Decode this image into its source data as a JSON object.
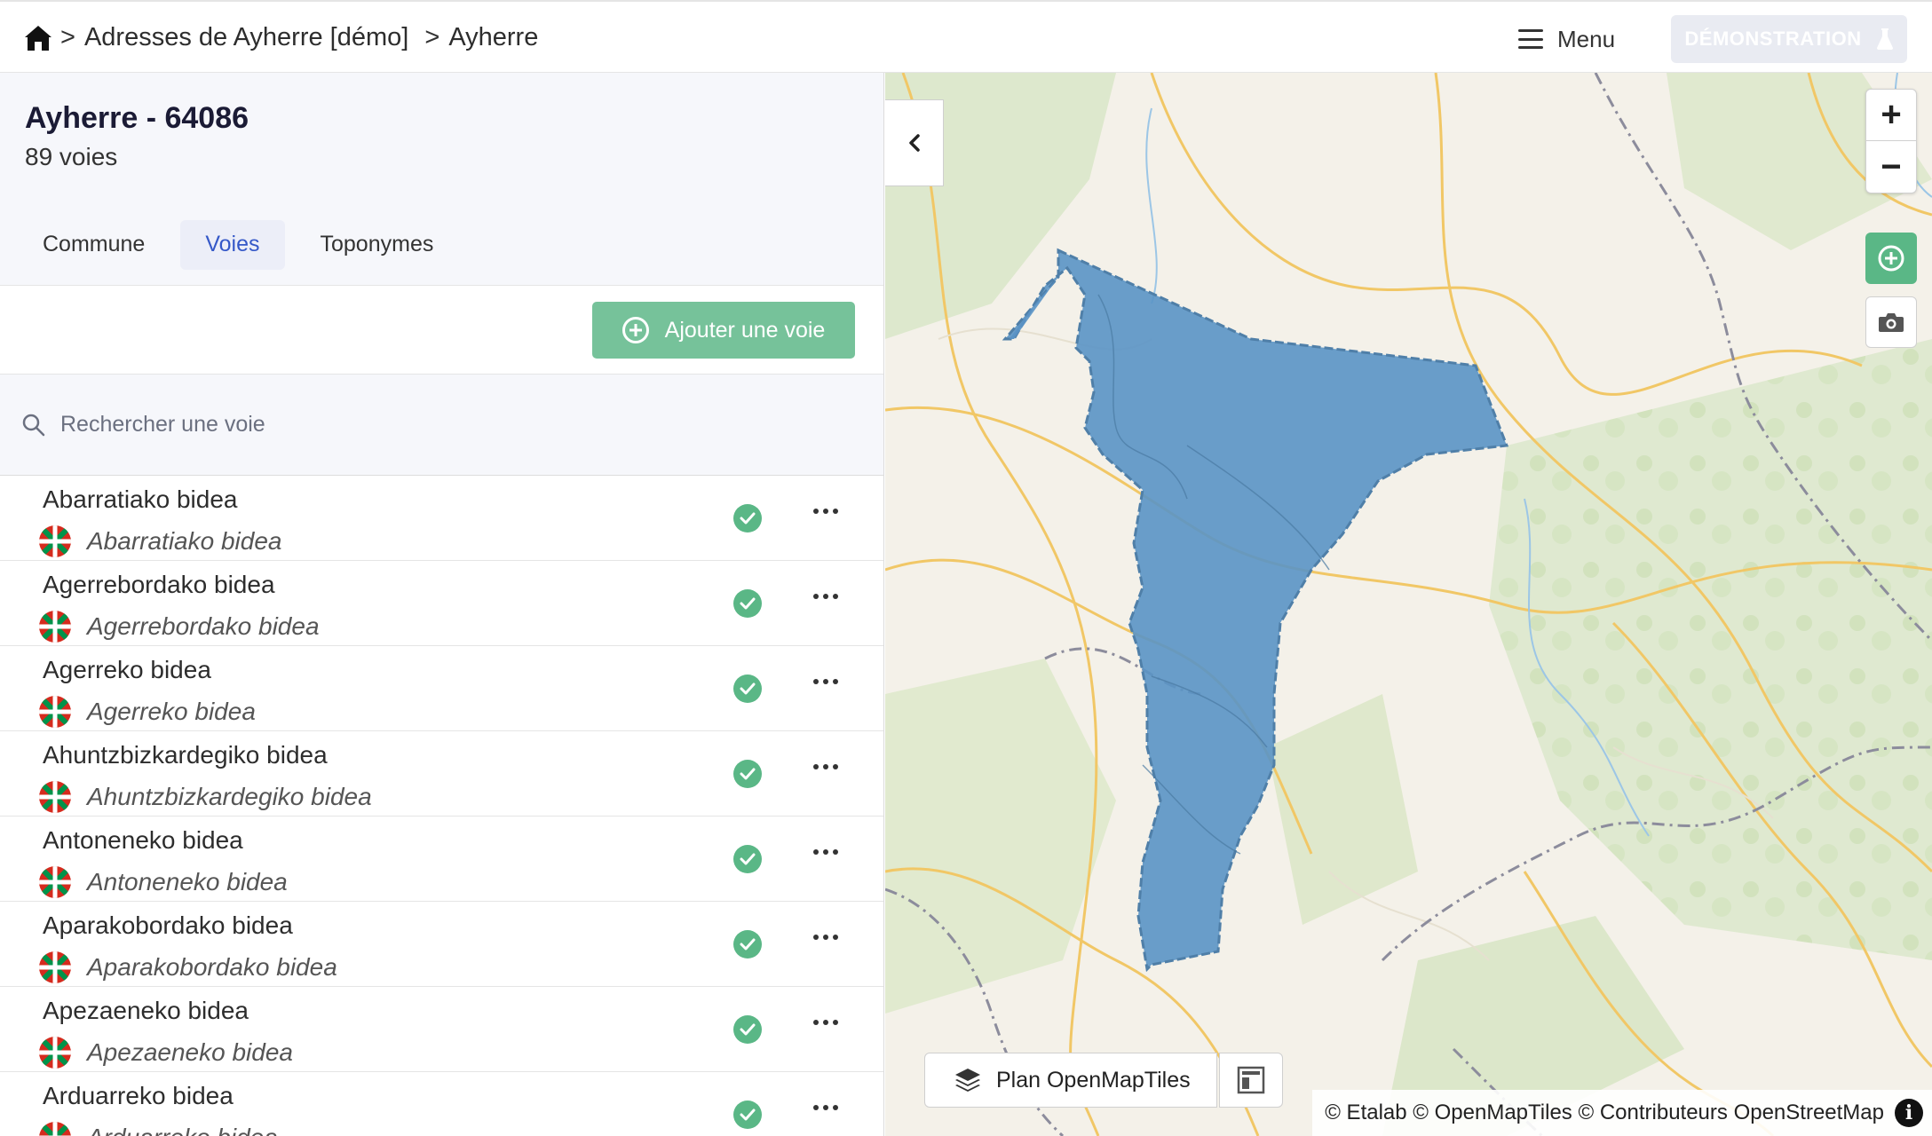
{
  "header": {
    "breadcrumb": [
      {
        "label": "Adresses de Ayherre [démo]"
      },
      {
        "label": "Ayherre"
      }
    ],
    "separator": ">",
    "menu_label": "Menu",
    "demo_label": "DÉMONSTRATION"
  },
  "sidebar": {
    "title": "Ayherre - 64086",
    "count": "89 voies",
    "tabs": [
      {
        "label": "Commune",
        "active": false
      },
      {
        "label": "Voies",
        "active": true
      },
      {
        "label": "Toponymes",
        "active": false
      }
    ],
    "add_button": "Ajouter une voie",
    "search_placeholder": "Rechercher une voie",
    "voies": [
      {
        "name": "Abarratiako bidea",
        "alt": "Abarratiako bidea"
      },
      {
        "name": "Agerrebordako bidea",
        "alt": "Agerrebordako bidea"
      },
      {
        "name": "Agerreko bidea",
        "alt": "Agerreko bidea"
      },
      {
        "name": "Ahuntzbizkardegiko bidea",
        "alt": "Ahuntzbizkardegiko bidea"
      },
      {
        "name": "Antoneneko bidea",
        "alt": "Antoneneko bidea"
      },
      {
        "name": "Aparakobordako bidea",
        "alt": "Aparakobordako bidea"
      },
      {
        "name": "Apezaeneko bidea",
        "alt": "Apezaeneko bidea"
      },
      {
        "name": "Arduarreko bidea",
        "alt": "Arduarreko bidea"
      }
    ]
  },
  "map": {
    "style_label": "Plan OpenMapTiles",
    "attribution": "© Etalab © OpenMapTiles © Contributeurs OpenStreetMap",
    "zoom_in": "+",
    "zoom_out": "−",
    "info": "i",
    "colors": {
      "commune_fill": "#5a93c5",
      "green": "#5ab786",
      "road": "#f3c96b"
    }
  }
}
